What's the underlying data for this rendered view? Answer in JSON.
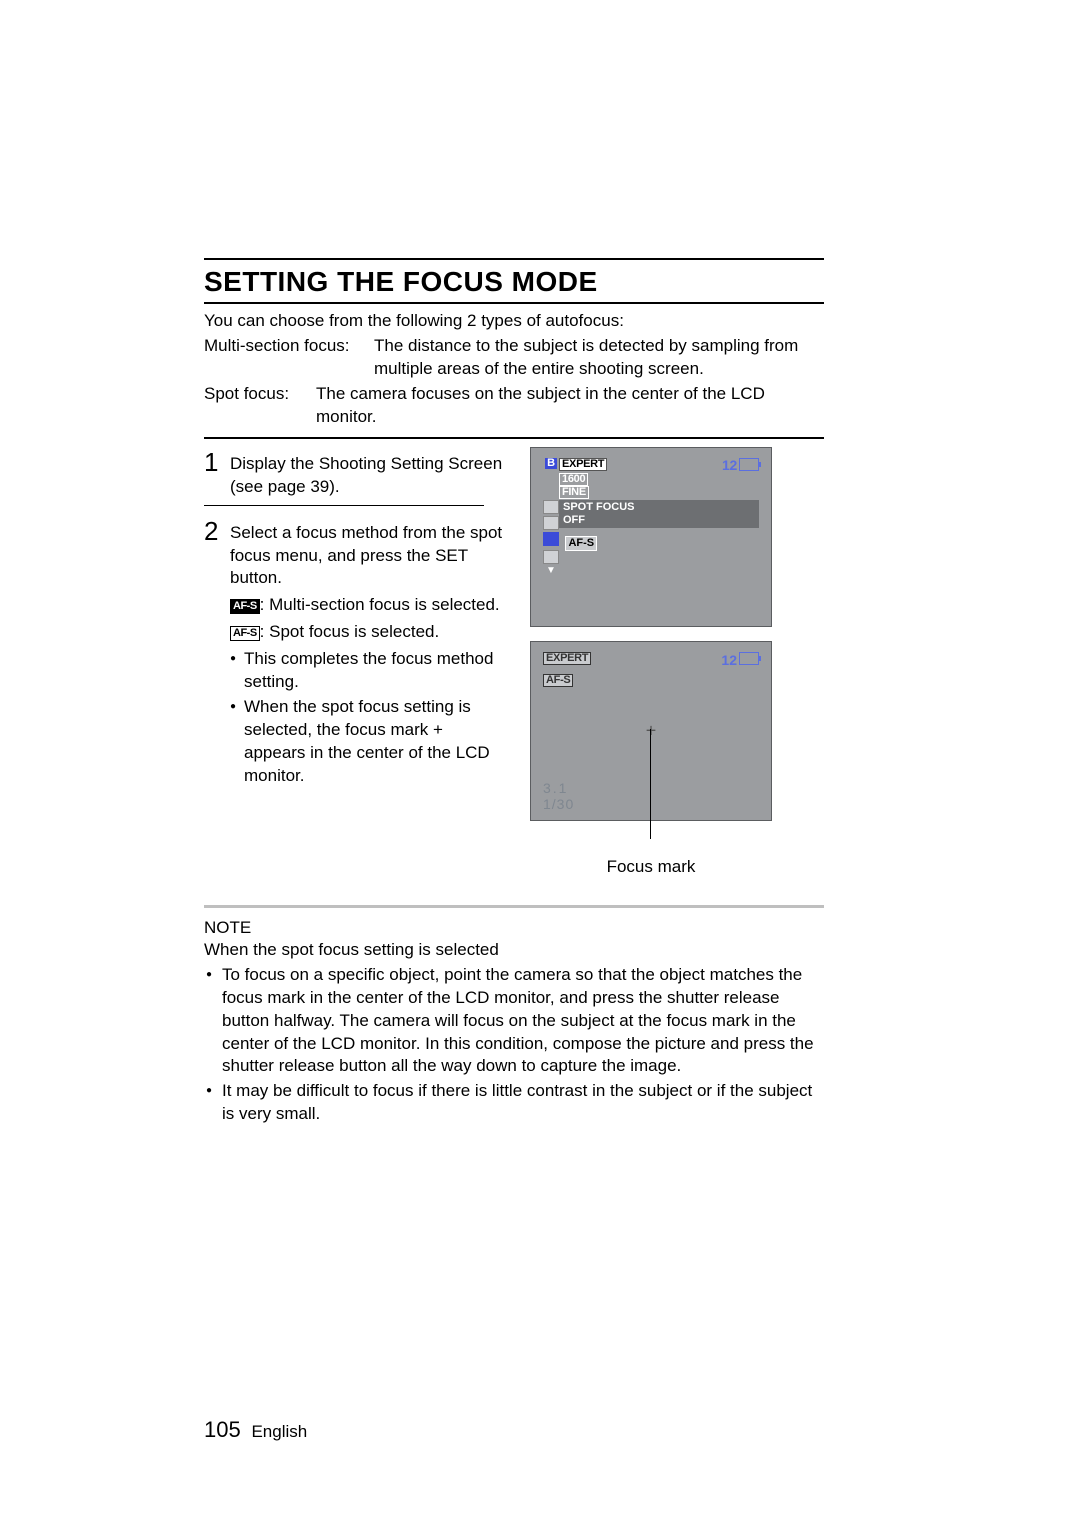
{
  "title": "SETTING THE FOCUS MODE",
  "intro": "You can choose from the following 2 types of autofocus:",
  "defs": {
    "multi_label": "Multi-section focus:",
    "multi_body": "The distance to the subject is detected by sampling from multiple areas of the entire shooting screen.",
    "spot_label": "Spot focus:",
    "spot_body": "The camera focuses on the subject in the center of the LCD monitor."
  },
  "steps": {
    "s1_num": "1",
    "s1_text": "Display the Shooting Setting Screen (see page 39).",
    "s2_num": "2",
    "s2_text": "Select a focus method from the spot focus menu, and press the SET button.",
    "s2_icon_multi": "AF-S",
    "s2_multi_desc": ": Multi-section focus is selected.",
    "s2_icon_spot": "AF-S",
    "s2_spot_desc": ": Spot focus is selected.",
    "s2_b1": "This completes the focus method setting.",
    "s2_b2": "When the spot focus setting is selected, the focus mark + appears in the center of the LCD monitor."
  },
  "lcd1": {
    "b": "B",
    "expert": "EXPERT",
    "count": "12",
    "res": "1600",
    "quality": "FINE",
    "menu_title": "SPOT  FOCUS",
    "menu_value": "OFF",
    "af": "AF-S",
    "darrow": "▼"
  },
  "lcd2": {
    "expert": "EXPERT",
    "count": "12",
    "af": "AF-S",
    "plus": "+",
    "aperture": "3.1",
    "shutter": "1/30"
  },
  "focus_mark_label": "Focus mark",
  "note": {
    "head": "NOTE",
    "sub": "When the spot focus setting is selected",
    "b1": "To focus on a specific object, point the camera so that the object matches the focus mark in the center of the LCD monitor, and press the shutter release button halfway. The camera will focus on the subject at the focus mark in the center of the LCD monitor. In this condition, compose the picture and press the shutter release button all the way down to capture the image.",
    "b2": "It may be difficult to focus if there is little contrast in the subject or if the subject is very small."
  },
  "footer": {
    "page": "105",
    "lang": "English"
  }
}
